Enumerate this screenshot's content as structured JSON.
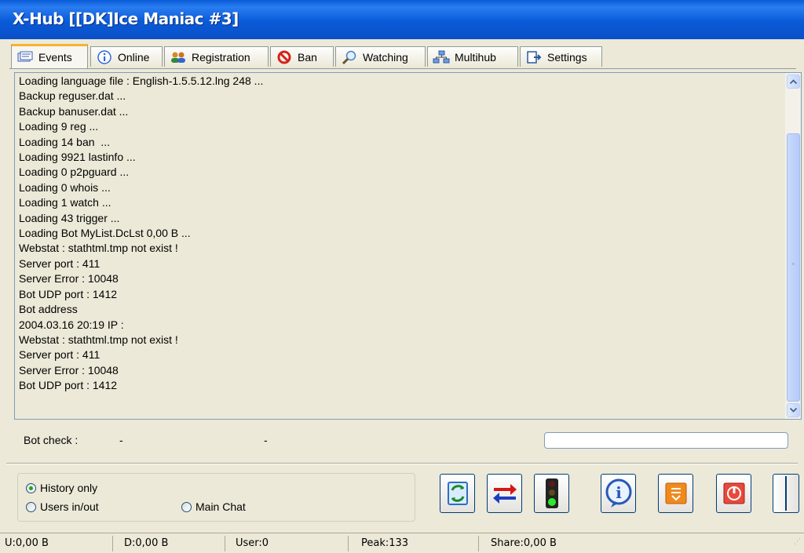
{
  "window": {
    "title": "X-Hub [[DK]Ice Maniac #3]"
  },
  "tabs": [
    {
      "label": "Events",
      "icon": "events-icon"
    },
    {
      "label": "Online",
      "icon": "info-icon"
    },
    {
      "label": "Registration",
      "icon": "users-icon"
    },
    {
      "label": "Ban",
      "icon": "ban-icon"
    },
    {
      "label": "Watching",
      "icon": "magnifier-icon"
    },
    {
      "label": "Multihub",
      "icon": "network-icon"
    },
    {
      "label": "Settings",
      "icon": "settings-icon"
    }
  ],
  "log_lines": [
    "Loading language file : English-1.5.5.12.lng 248 ...",
    "Backup reguser.dat ...",
    "Backup banuser.dat ...",
    "Loading 9 reg ...",
    "Loading 14 ban  ...",
    "Loading 9921 lastinfo ...",
    "Loading 0 p2pguard ...",
    "Loading 0 whois ...",
    "Loading 1 watch ...",
    "Loading 43 trigger ...",
    "Loading Bot MyList.DcLst 0,00 B ...",
    "Webstat : stathtml.tmp not exist !",
    "Server port : 411",
    "Server Error : 10048",
    "Bot UDP port : 1412",
    "Bot address",
    "2004.03.16 20:19 IP :",
    "Webstat : stathtml.tmp not exist !",
    "Server port : 411",
    "Server Error : 10048",
    "Bot UDP port : 1412"
  ],
  "botcheck": {
    "label": "Bot check :",
    "value1": "-",
    "value2": "-"
  },
  "radios": {
    "history_only": "History only",
    "users_inout": "Users in/out",
    "main_chat": "Main Chat",
    "selected": "history_only"
  },
  "toolbar": [
    "refresh-icon",
    "swap-arrows-icon",
    "traffic-light-icon",
    "info-bubble-icon",
    "notepad-icon",
    "power-icon"
  ],
  "status": {
    "upload": "U:0,00 B",
    "download": "D:0,00 B",
    "users": "User:0",
    "peak": "Peak:133",
    "share": "Share:0,00 B"
  }
}
